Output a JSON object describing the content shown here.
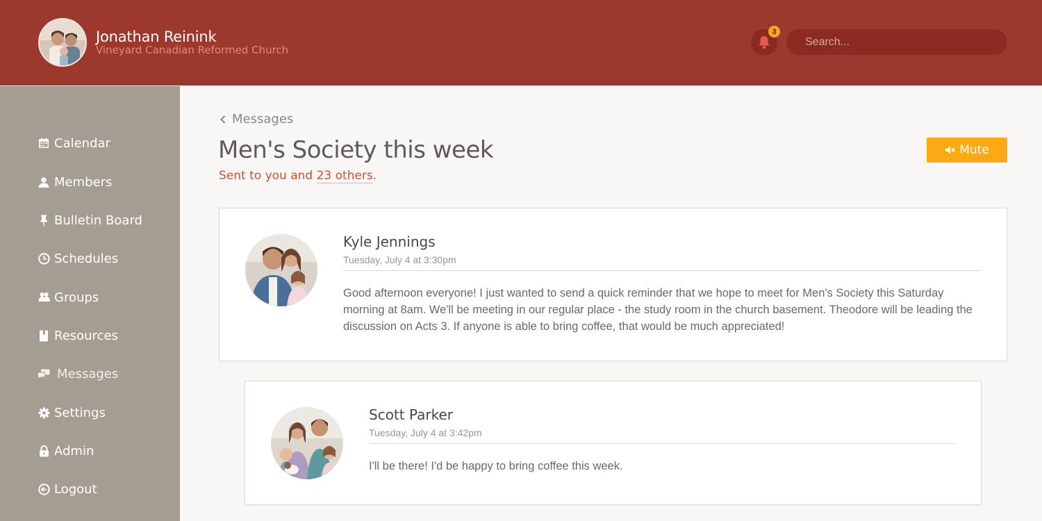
{
  "header": {
    "user_name": "Jonathan Reinink",
    "church_name": "Vineyard Canadian Reformed Church",
    "notification_count": "3",
    "search_placeholder": "Search..."
  },
  "sidebar": {
    "items": [
      {
        "label": "Calendar",
        "icon": "calendar-icon"
      },
      {
        "label": "Members",
        "icon": "user-icon"
      },
      {
        "label": "Bulletin Board",
        "icon": "pin-icon"
      },
      {
        "label": "Schedules",
        "icon": "clock-icon"
      },
      {
        "label": "Groups",
        "icon": "group-icon"
      },
      {
        "label": "Resources",
        "icon": "book-icon"
      },
      {
        "label": "Messages",
        "icon": "chat-icon"
      },
      {
        "label": "Settings",
        "icon": "gear-icon"
      },
      {
        "label": "Admin",
        "icon": "lock-icon"
      },
      {
        "label": "Logout",
        "icon": "logout-icon"
      }
    ]
  },
  "main": {
    "back_label": "Messages",
    "title": "Men's Society this week",
    "sent_prefix": "Sent to you and ",
    "sent_link": "23 others",
    "sent_suffix": ".",
    "mute_label": "Mute"
  },
  "messages": [
    {
      "author": "Kyle Jennings",
      "time": "Tuesday, July 4 at 3:30pm",
      "body": "Good afternoon everyone! I just wanted to send a quick reminder that we hope to meet for Men's Society this Saturday morning at 8am. We'll be meeting in our regular place - the study room in the church basement. Theodore will be leading the discussion on Acts 3. If anyone is able to bring coffee, that would be much appreciated!"
    },
    {
      "author": "Scott Parker",
      "time": "Tuesday, July 4 at 3:42pm",
      "body": "I'll be there! I'd be happy to bring coffee this week."
    }
  ],
  "colors": {
    "header_bg": "#9c382c",
    "sidebar_bg": "#a59d92",
    "accent_orange": "#fbaa14",
    "accent_red_text": "#d34f2f"
  }
}
